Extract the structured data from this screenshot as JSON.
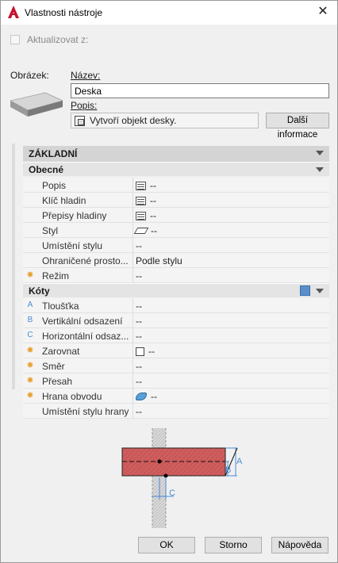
{
  "window": {
    "title": "Vlastnosti nástroje",
    "close": "✕"
  },
  "update": {
    "label": "Aktualizovat z:",
    "checked": false
  },
  "picture_label": "Obrázek:",
  "name": {
    "label": "Název:",
    "value": "Deska"
  },
  "description": {
    "label": "Popis:",
    "value": "Vytvoří objekt desky.",
    "more_button": "Další informace"
  },
  "palette": {
    "category": "ZÁKLADNÍ",
    "general": {
      "header": "Obecné",
      "rows": [
        {
          "name": "Popis",
          "value": "--",
          "icon": "list-icon",
          "marker": ""
        },
        {
          "name": "Klíč hladin",
          "value": "--",
          "icon": "list-icon",
          "marker": ""
        },
        {
          "name": "Přepisy hladiny",
          "value": "--",
          "icon": "list-icon",
          "marker": ""
        },
        {
          "name": "Styl",
          "value": "--",
          "icon": "parallelogram-icon",
          "marker": ""
        },
        {
          "name": "Umístění stylu",
          "value": "--",
          "icon": "",
          "marker": ""
        },
        {
          "name": "Ohraničené  prosto...",
          "value": "Podle stylu",
          "icon": "",
          "marker": ""
        },
        {
          "name": "Režim",
          "value": "--",
          "icon": "",
          "marker": "star"
        }
      ]
    },
    "dimensions": {
      "header": "Kóty",
      "rows": [
        {
          "name": "Tloušťka",
          "value": "--",
          "icon": "",
          "marker": "A"
        },
        {
          "name": "Vertikální odsazení",
          "value": "--",
          "icon": "",
          "marker": "B"
        },
        {
          "name": "Horizontální  odsaz...",
          "value": "--",
          "icon": "",
          "marker": "C"
        },
        {
          "name": "Zarovnat",
          "value": "--",
          "icon": "square-icon",
          "marker": "star"
        },
        {
          "name": "Směr",
          "value": "--",
          "icon": "",
          "marker": "star"
        },
        {
          "name": "Přesah",
          "value": "--",
          "icon": "",
          "marker": "star"
        },
        {
          "name": "Hrana obvodu",
          "value": "--",
          "icon": "edge-icon",
          "marker": "star"
        },
        {
          "name": "Umístění stylu hrany",
          "value": "--",
          "icon": "",
          "marker": ""
        }
      ]
    }
  },
  "diagram_labels": {
    "a": "A",
    "b": "B",
    "c": "C"
  },
  "buttons": {
    "ok": "OK",
    "cancel": "Storno",
    "help": "Nápověda"
  },
  "colors": {
    "slab": "#c85a5a",
    "accent": "#4a8bd4",
    "star": "#e8a23a",
    "app_icon": "#c8102e"
  }
}
